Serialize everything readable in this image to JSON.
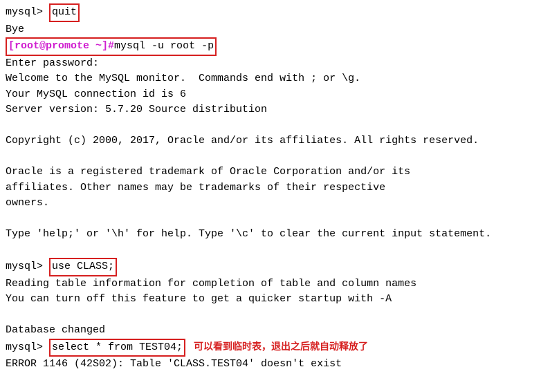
{
  "lines": {
    "l1_prompt": "mysql> ",
    "l1_cmd": "quit",
    "l2": "Bye",
    "l3_prompt": "[root@promote ~]",
    "l3_hash": "#",
    "l3_cmd": "mysql -u root -p",
    "l4": "Enter password:",
    "l5": "Welcome to the MySQL monitor.  Commands end with ; or \\g.",
    "l6": "Your MySQL connection id is 6",
    "l7": "Server version: 5.7.20 Source distribution",
    "l8": "",
    "l9": "Copyright (c) 2000, 2017, Oracle and/or its affiliates. All rights reserved.",
    "l10": "",
    "l11": "Oracle is a registered trademark of Oracle Corporation and/or its",
    "l12": "affiliates. Other names may be trademarks of their respective",
    "l13": "owners.",
    "l14": "",
    "l15": "Type 'help;' or '\\h' for help. Type '\\c' to clear the current input statement.",
    "l16": "",
    "l17_prompt": "mysql> ",
    "l17_cmd": "use CLASS;",
    "l18": "Reading table information for completion of table and column names",
    "l19": "You can turn off this feature to get a quicker startup with -A",
    "l20": "",
    "l21": "Database changed",
    "l22_prompt": "mysql> ",
    "l22_cmd": "select * from TEST04;",
    "l22_note": "可以看到临时表，退出之后就自动释放了",
    "l23": "ERROR 1146 (42S02): Table 'CLASS.TEST04' doesn't exist"
  }
}
